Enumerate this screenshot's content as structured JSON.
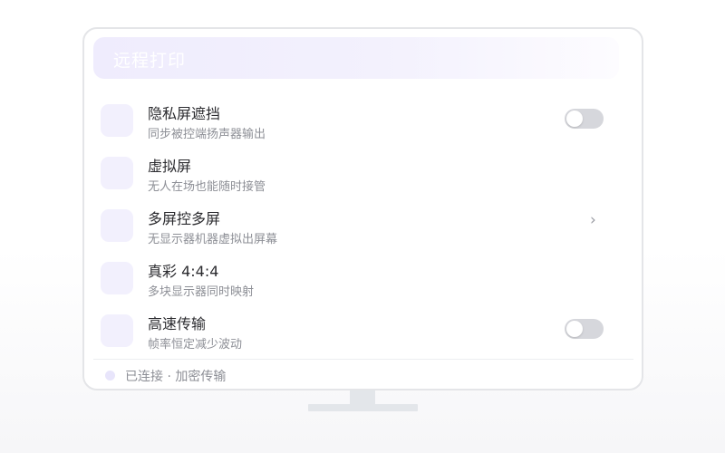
{
  "header": {
    "title": "远程打印"
  },
  "rows": [
    {
      "title": "隐私屏遮挡",
      "subtitle": "同步被控端扬声器输出",
      "control": "toggle",
      "toggle_on": false
    },
    {
      "title": "虚拟屏",
      "subtitle": "无人在场也能随时接管",
      "control": "none"
    },
    {
      "title": "多屏控多屏",
      "subtitle": "无显示器机器虚拟出屏幕",
      "control": "chevron",
      "chevron": "›"
    },
    {
      "title": "真彩 4:4:4",
      "subtitle": "多块显示器同时映射",
      "control": "none"
    },
    {
      "title": "高速传输",
      "subtitle": "帧率恒定减少波动",
      "control": "toggle",
      "toggle_on": false
    }
  ],
  "status": {
    "text": "已连接 · 加密传输"
  },
  "colors": {
    "accent_soft": "#efecfd",
    "toggle_off": "#d6d7dc",
    "text_primary": "#2b2b2f",
    "text_secondary": "#8d8f96"
  },
  "icons": {
    "row_icon": "feature-icon",
    "chevron": "chevron-right-icon",
    "status_dot": "status-dot-icon"
  }
}
